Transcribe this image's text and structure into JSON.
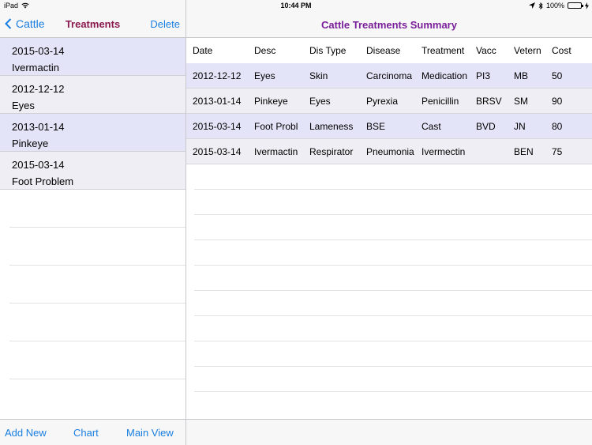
{
  "status_bar": {
    "device": "iPad",
    "time": "10:44 PM",
    "battery": "100%",
    "battery_level": 1.0
  },
  "left_pane": {
    "back_label": "Cattle",
    "title": "Treatments",
    "delete_label": "Delete",
    "items": [
      {
        "date": "2015-03-14",
        "name": "Ivermactin"
      },
      {
        "date": "2012-12-12",
        "name": "Eyes"
      },
      {
        "date": "2013-01-14",
        "name": "Pinkeye"
      },
      {
        "date": "2015-03-14",
        "name": "Foot Problem"
      }
    ],
    "toolbar": {
      "add_new": "Add New",
      "chart": "Chart",
      "main_view": "Main View"
    }
  },
  "right_pane": {
    "title": "Cattle Treatments Summary",
    "table": {
      "headers": [
        "Date",
        "Desc",
        "Dis Type",
        "Disease",
        "Treatment",
        "Vacc",
        "Vetern",
        "Cost"
      ],
      "rows": [
        [
          "2012-12-12",
          "Eyes",
          "Skin",
          "Carcinoma",
          "Medication",
          "PI3",
          "MB",
          "50"
        ],
        [
          "2013-01-14",
          "Pinkeye",
          "Eyes",
          "Pyrexia",
          "Penicillin",
          "BRSV",
          "SM",
          "90"
        ],
        [
          "2015-03-14",
          "Foot Probl",
          "Lameness",
          "BSE",
          "Cast",
          "BVD",
          "JN",
          "80"
        ],
        [
          "2015-03-14",
          "Ivermactin",
          "Respirator",
          "Pneumonia",
          "Ivermectin",
          "",
          "BEN",
          "75"
        ]
      ]
    }
  },
  "colors": {
    "accent_blue": "#1a7fe0",
    "left_title": "#8b1a50",
    "right_title": "#7a1f9a",
    "row_highlight": "#e4e4f8",
    "row_alt": "#eeeef4"
  }
}
